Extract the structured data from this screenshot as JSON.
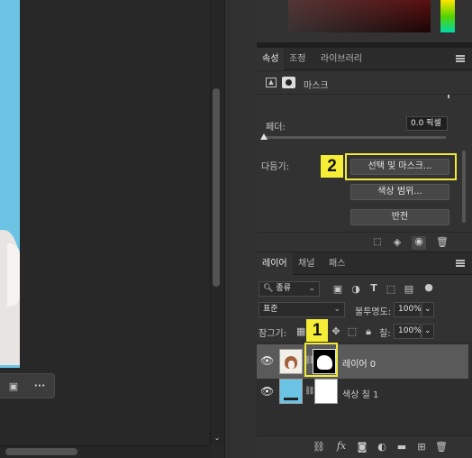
{
  "properties_panel": {
    "tabs": [
      "속성",
      "조정",
      "라이브러리"
    ],
    "active_tab": "속성",
    "mask_label": "마스크",
    "feather_label": "페더:",
    "feather_value": "0.0 픽셀",
    "refine_label": "다듬기:",
    "select_mask_button": "선택 및 마스크...",
    "color_range_button": "색상 범위...",
    "invert_button": "반전"
  },
  "layers_panel": {
    "tabs": [
      "레이어",
      "채널",
      "패스"
    ],
    "active_tab": "레이어",
    "filter_kind": "종류",
    "blend_mode": "표준",
    "opacity_label": "불투명도:",
    "opacity_value": "100%",
    "lock_label": "잠그기:",
    "fill_label": "칠:",
    "fill_value": "100%",
    "layers": [
      {
        "name": "레이어 0",
        "selected": true
      },
      {
        "name": "색상 칠 1",
        "selected": false
      }
    ]
  },
  "callouts": {
    "one": "1",
    "two": "2"
  },
  "float_toolbar": {
    "more": "···"
  },
  "colors": {
    "highlight": "#f2ea3a",
    "canvas_blue": "#6cc4e4",
    "panel_bg": "#323232"
  }
}
